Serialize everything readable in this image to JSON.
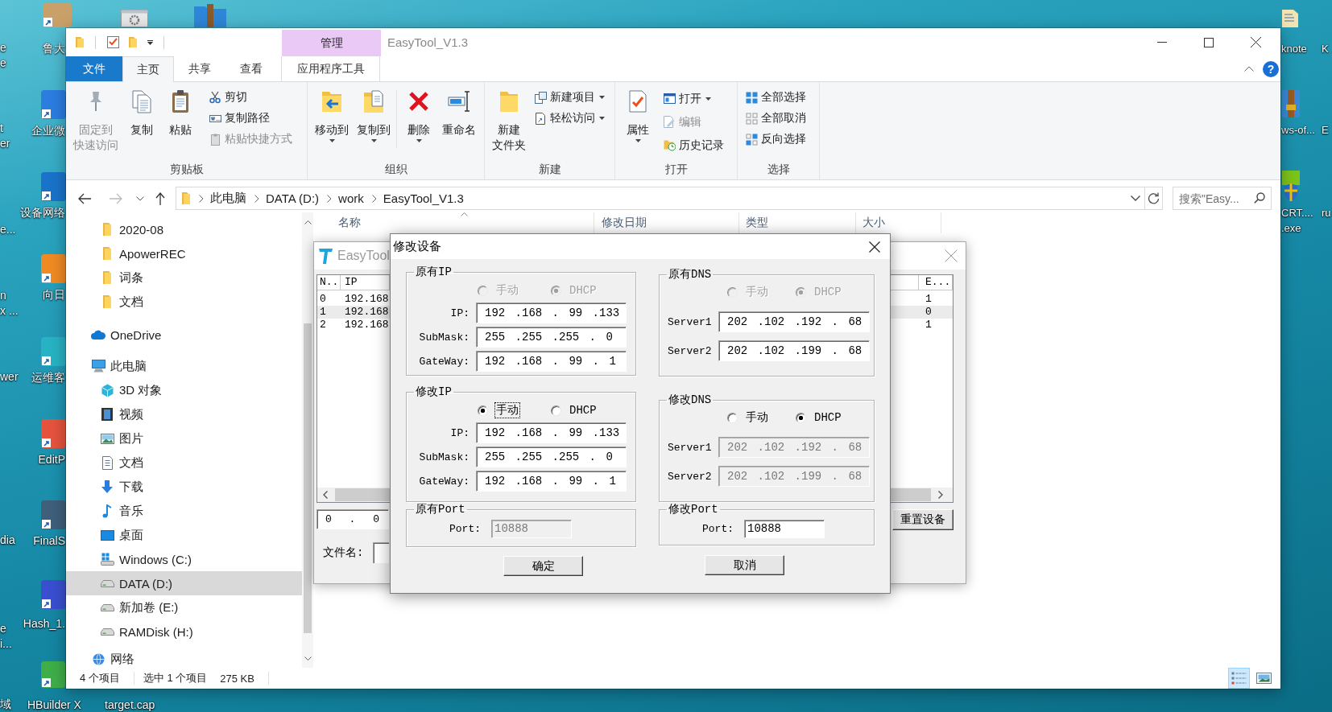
{
  "desktop": {
    "edge_labels": [
      [
        "e",
        "e"
      ],
      [
        "t",
        "er"
      ],
      [
        "e..."
      ],
      [
        "n",
        "x ..."
      ],
      [
        "wer"
      ],
      [
        "dia"
      ],
      [
        "e",
        "i..."
      ],
      [
        "域"
      ]
    ],
    "shortcuts": [
      "鲁大",
      "企业微",
      "设备网络",
      "向日",
      "运维客",
      "EditP",
      "FinalS",
      "Hash_1.",
      "HBuilder X"
    ],
    "bottom_labels": [
      "target.cap"
    ],
    "right_labels": [
      [
        "knote"
      ],
      [
        "ws-of..."
      ],
      [
        "CRT....",
        ".exe"
      ]
    ],
    "far_right_labels": [
      "K",
      "E",
      "ru"
    ]
  },
  "explorer": {
    "context_group": "管理",
    "title": "EasyTool_V1.3",
    "tabs": [
      {
        "label": "文件",
        "kind": "file",
        "selected": false
      },
      {
        "label": "主页",
        "kind": "tab",
        "selected": true
      },
      {
        "label": "共享",
        "kind": "tab",
        "selected": false
      },
      {
        "label": "查看",
        "kind": "tab",
        "selected": false
      },
      {
        "label": "应用程序工具",
        "kind": "context",
        "selected": false
      }
    ],
    "help": "?",
    "ribbon": [
      {
        "label": "剪贴板",
        "large": [
          {
            "lines": [
              "固定到",
              "快速访问"
            ],
            "kind": "pin",
            "disabled": true,
            "menu": false
          },
          {
            "lines": [
              "复制"
            ],
            "kind": "copy",
            "disabled": false,
            "menu": false
          },
          {
            "lines": [
              "粘贴"
            ],
            "kind": "paste",
            "disabled": false,
            "menu": false
          }
        ],
        "small": [
          {
            "label": "剪切",
            "kind": "scissors",
            "disabled": false,
            "menu": false
          },
          {
            "label": "复制路径",
            "kind": "path",
            "disabled": false,
            "menu": false
          },
          {
            "label": "粘贴快捷方式",
            "kind": "shortcut",
            "disabled": true,
            "menu": false
          }
        ]
      },
      {
        "label": "组织",
        "large": [
          {
            "lines": [
              "移动到"
            ],
            "kind": "move",
            "disabled": false,
            "menu": true
          },
          {
            "lines": [
              "复制到"
            ],
            "kind": "copyto",
            "disabled": false,
            "menu": true
          },
          {
            "lines": [
              "删除"
            ],
            "kind": "delete",
            "disabled": false,
            "menu": true
          },
          {
            "lines": [
              "重命名"
            ],
            "kind": "rename",
            "disabled": false,
            "menu": false
          }
        ]
      },
      {
        "label": "新建",
        "large": [
          {
            "lines": [
              "新建",
              "文件夹"
            ],
            "kind": "newfolder",
            "disabled": false,
            "menu": false
          }
        ],
        "small": [
          {
            "label": "新建项目",
            "kind": "newitem",
            "disabled": false,
            "menu": true
          },
          {
            "label": "轻松访问",
            "kind": "easyaccess",
            "disabled": false,
            "menu": true
          }
        ]
      },
      {
        "label": "打开",
        "large": [
          {
            "lines": [
              "属性"
            ],
            "kind": "properties",
            "disabled": false,
            "menu": true
          }
        ],
        "small": [
          {
            "label": "打开",
            "kind": "open",
            "disabled": false,
            "menu": true
          },
          {
            "label": "编辑",
            "kind": "edit",
            "disabled": true,
            "menu": false
          },
          {
            "label": "历史记录",
            "kind": "history",
            "disabled": false,
            "menu": false
          }
        ]
      },
      {
        "label": "选择",
        "small": [
          {
            "label": "全部选择",
            "kind": "selectall",
            "disabled": false,
            "menu": false
          },
          {
            "label": "全部取消",
            "kind": "selectnone",
            "disabled": false,
            "menu": false
          },
          {
            "label": "反向选择",
            "kind": "invert",
            "disabled": false,
            "menu": false
          }
        ]
      }
    ],
    "address": [
      "此电脑",
      "DATA (D:)",
      "work",
      "EasyTool_V1.3"
    ],
    "search_placeholder": "搜索\"Easy...",
    "nav": {
      "pinned": [
        {
          "label": "2020-08",
          "kind": "folder",
          "selected": false
        },
        {
          "label": "ApowerREC",
          "kind": "folder",
          "selected": false
        },
        {
          "label": "词条",
          "kind": "folder",
          "selected": false
        },
        {
          "label": "文档",
          "kind": "folder",
          "selected": false
        }
      ],
      "tree": [
        {
          "label": "OneDrive",
          "kind": "cloud",
          "selected": false
        },
        {
          "label": "此电脑",
          "kind": "computer",
          "selected": false,
          "children": [
            {
              "label": "3D 对象",
              "kind": "cube",
              "selected": false
            },
            {
              "label": "视频",
              "kind": "video",
              "selected": false
            },
            {
              "label": "图片",
              "kind": "picture",
              "selected": false
            },
            {
              "label": "文档",
              "kind": "document",
              "selected": false
            },
            {
              "label": "下载",
              "kind": "download",
              "selected": false
            },
            {
              "label": "音乐",
              "kind": "music",
              "selected": false
            },
            {
              "label": "桌面",
              "kind": "desktop",
              "selected": false
            },
            {
              "label": "Windows (C:)",
              "kind": "windows_drive",
              "selected": false
            },
            {
              "label": "DATA (D:)",
              "kind": "drive",
              "selected": true
            },
            {
              "label": "新加卷 (E:)",
              "kind": "drive",
              "selected": false
            },
            {
              "label": "RAMDisk (H:)",
              "kind": "drive",
              "selected": false
            }
          ]
        },
        {
          "label": "网络",
          "kind": "network",
          "selected": false
        }
      ]
    },
    "columns": [
      {
        "label": "名称",
        "sorted": true
      },
      {
        "label": "修改日期",
        "sorted": false
      },
      {
        "label": "类型",
        "sorted": false
      },
      {
        "label": "大小",
        "sorted": false
      }
    ],
    "status": [
      "4 个项目",
      "选中 1 个项目",
      "275 KB"
    ],
    "views": [
      {
        "kind": "details",
        "selected": true
      },
      {
        "kind": "large_icons",
        "selected": false
      }
    ]
  },
  "easytool": {
    "title": "EasyTool",
    "columns": [
      "N..",
      "IP",
      "E..."
    ],
    "rows": [
      {
        "cells": [
          "0",
          "192.168",
          "1"
        ],
        "selected": false
      },
      {
        "cells": [
          "1",
          "192.168",
          "0"
        ],
        "selected": true
      },
      {
        "cells": [
          "2",
          "192.168",
          "1"
        ],
        "selected": false
      }
    ],
    "address_value": "0 . 0",
    "reset_button": "重置设备",
    "file_label": "文件名:"
  },
  "dialog": {
    "title": "修改设备",
    "columns": [
      {
        "groups": [
          {
            "kind": "ip",
            "title": "原有IP",
            "radios": [
              {
                "label": "手动",
                "selected": false,
                "disabled": true,
                "focused": false
              },
              {
                "label": "DHCP",
                "selected": true,
                "disabled": true,
                "focused": false
              }
            ],
            "fields": [
              {
                "label": "IP:",
                "value": "192 .168 . 99 .133",
                "disabled": false
              },
              {
                "label": "SubMask:",
                "value": "255 .255 .255 . 0",
                "disabled": false
              },
              {
                "label": "GateWay:",
                "value": "192 .168 . 99 . 1",
                "disabled": false
              }
            ]
          },
          {
            "kind": "ip",
            "title": "修改IP",
            "radios": [
              {
                "label": "手动",
                "selected": true,
                "disabled": false,
                "focused": true
              },
              {
                "label": "DHCP",
                "selected": false,
                "disabled": false,
                "focused": false
              }
            ],
            "fields": [
              {
                "label": "IP:",
                "value": "192 .168 . 99 .133",
                "disabled": false
              },
              {
                "label": "SubMask:",
                "value": "255 .255 .255 . 0",
                "disabled": false
              },
              {
                "label": "GateWay:",
                "value": "192 .168 . 99 . 1",
                "disabled": false
              }
            ]
          },
          {
            "kind": "port",
            "title": "原有Port",
            "fields": [
              {
                "label": "Port:",
                "value": "10888",
                "disabled": true
              }
            ]
          }
        ],
        "button": "确定"
      },
      {
        "groups": [
          {
            "kind": "dns",
            "title": "原有DNS",
            "radios": [
              {
                "label": "手动",
                "selected": false,
                "disabled": true,
                "focused": false
              },
              {
                "label": "DHCP",
                "selected": true,
                "disabled": true,
                "focused": false
              }
            ],
            "fields": [
              {
                "label": "Server1",
                "value": "202 .102 .192 . 68",
                "disabled": false
              },
              {
                "label": "Server2",
                "value": "202 .102 .199 . 68",
                "disabled": false
              }
            ]
          },
          {
            "kind": "dns",
            "title": "修改DNS",
            "radios": [
              {
                "label": "手动",
                "selected": false,
                "disabled": false,
                "focused": false
              },
              {
                "label": "DHCP",
                "selected": true,
                "disabled": false,
                "focused": false
              }
            ],
            "fields": [
              {
                "label": "Server1",
                "value": "202 .102 .192 . 68",
                "disabled": true
              },
              {
                "label": "Server2",
                "value": "202 .102 .199 . 68",
                "disabled": true
              }
            ]
          },
          {
            "kind": "port",
            "title": "修改Port",
            "fields": [
              {
                "label": "Port:",
                "value": "10888",
                "disabled": false
              }
            ]
          }
        ],
        "button": "取消"
      }
    ]
  }
}
